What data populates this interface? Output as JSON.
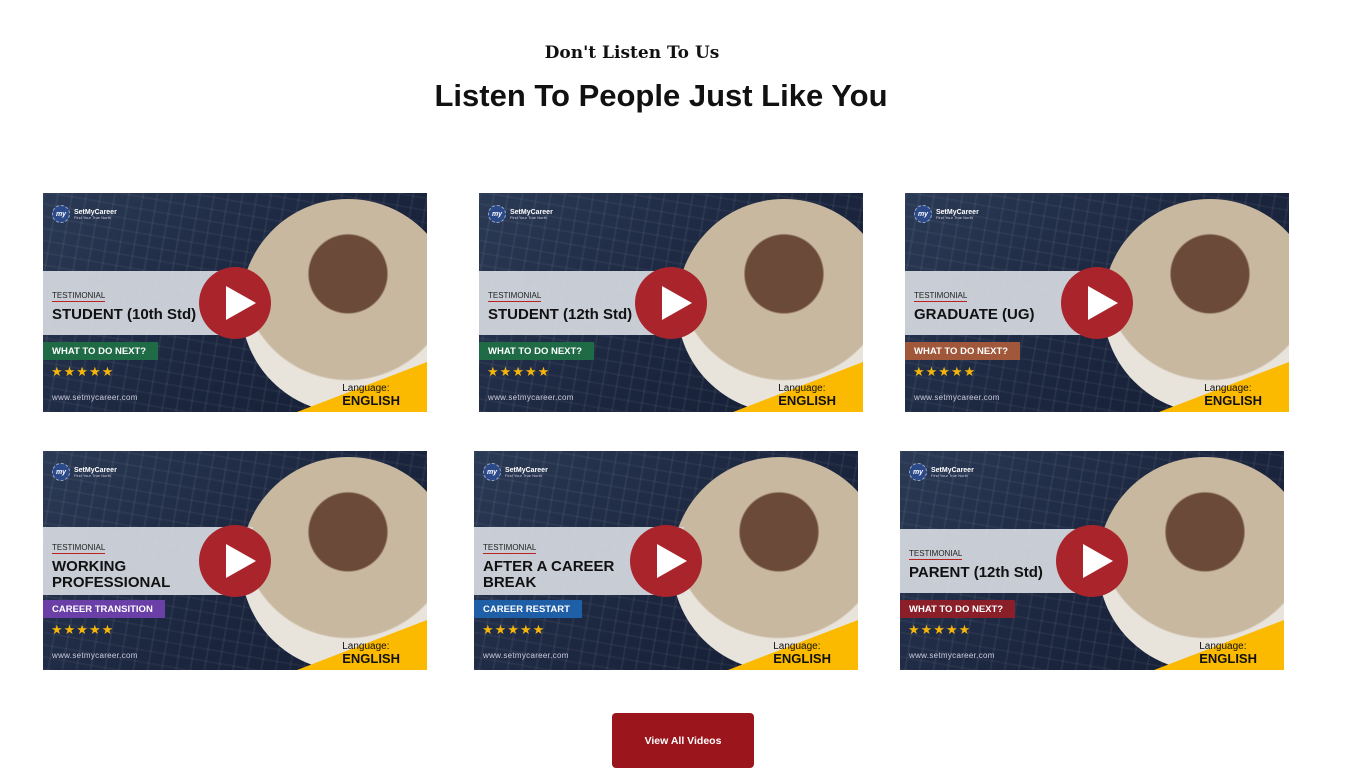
{
  "header": {
    "kicker": "Don't Listen To Us",
    "title": "Listen To People Just Like You"
  },
  "brand": {
    "name": "SetMyCareer",
    "tagline": "Find Your True North",
    "mark": "my",
    "url": "www.setmycareer.com"
  },
  "cards": [
    {
      "label": "TESTIMONIAL",
      "title": "STUDENT (10th Std)",
      "tag": "WHAT TO DO NEXT?",
      "tag_color": "#1e6b45",
      "rating": 5,
      "stars": "★★★★★",
      "language_label": "Language:",
      "language": "ENGLISH"
    },
    {
      "label": "TESTIMONIAL",
      "title": "STUDENT (12th Std)",
      "tag": "WHAT TO DO NEXT?",
      "tag_color": "#1e6b45",
      "rating": 5,
      "stars": "★★★★★",
      "language_label": "Language:",
      "language": "ENGLISH"
    },
    {
      "label": "TESTIMONIAL",
      "title": "GRADUATE (UG)",
      "tag": "WHAT TO DO NEXT?",
      "tag_color": "#a0573a",
      "rating": 5,
      "stars": "★★★★★",
      "language_label": "Language:",
      "language": "ENGLISH"
    },
    {
      "label": "TESTIMONIAL",
      "title": "WORKING PROFESSIONAL",
      "tag": "CAREER TRANSITION",
      "tag_color": "#6b3fa8",
      "rating": 5,
      "stars": "★★★★★",
      "language_label": "Language:",
      "language": "ENGLISH"
    },
    {
      "label": "TESTIMONIAL",
      "title": "AFTER A CAREER BREAK",
      "tag": "CAREER RESTART",
      "tag_color": "#1f5fa8",
      "rating": 5,
      "stars": "★★★★★",
      "language_label": "Language:",
      "language": "ENGLISH"
    },
    {
      "label": "TESTIMONIAL",
      "title": "PARENT (12th Std)",
      "tag": "WHAT TO DO NEXT?",
      "tag_color": "#8a1f2a",
      "rating": 5,
      "stars": "★★★★★",
      "language_label": "Language:",
      "language": "ENGLISH"
    }
  ],
  "button": {
    "label": "View All Videos"
  }
}
